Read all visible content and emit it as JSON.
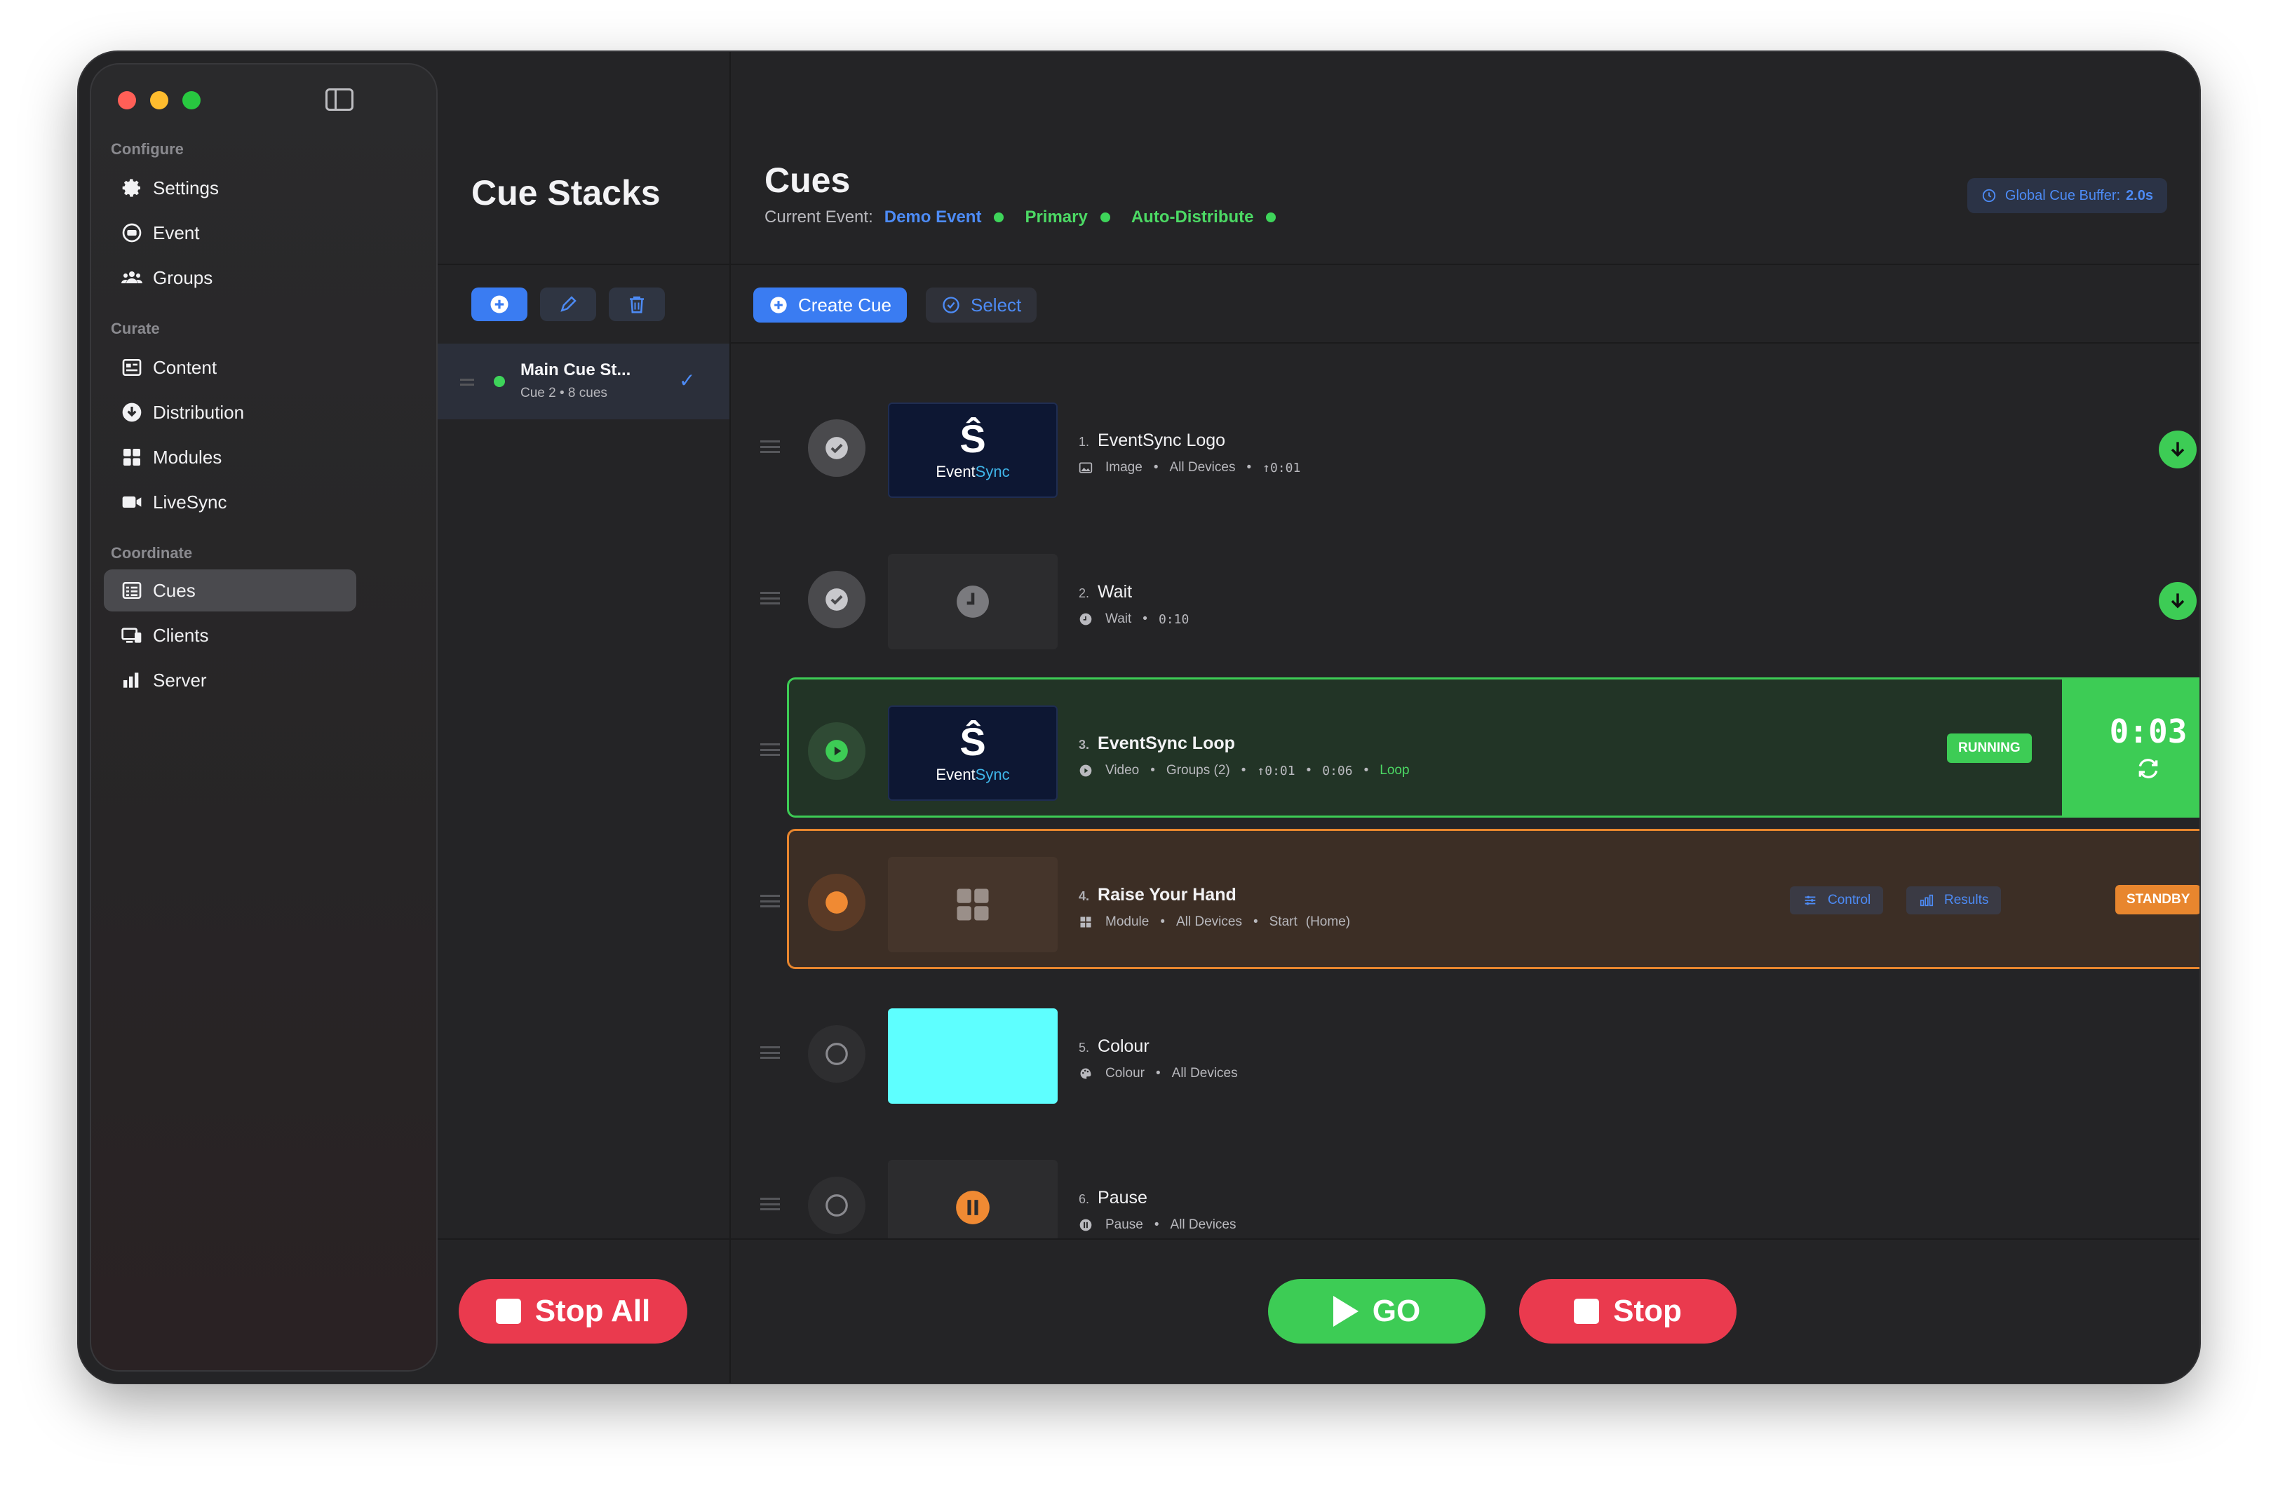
{
  "sidebar": {
    "sections": [
      {
        "title": "Configure",
        "items": [
          {
            "label": "Settings",
            "icon": "gear-icon"
          },
          {
            "label": "Event",
            "icon": "event-icon"
          },
          {
            "label": "Groups",
            "icon": "groups-icon"
          }
        ]
      },
      {
        "title": "Curate",
        "items": [
          {
            "label": "Content",
            "icon": "content-icon"
          },
          {
            "label": "Distribution",
            "icon": "download-circle-icon"
          },
          {
            "label": "Modules",
            "icon": "grid-icon"
          },
          {
            "label": "LiveSync",
            "icon": "video-camera-icon"
          }
        ]
      },
      {
        "title": "Coordinate",
        "items": [
          {
            "label": "Cues",
            "icon": "cues-list-icon",
            "active": true
          },
          {
            "label": "Clients",
            "icon": "clients-icon"
          },
          {
            "label": "Server",
            "icon": "server-chart-icon"
          }
        ]
      }
    ]
  },
  "stacks": {
    "title": "Cue Stacks",
    "items": [
      {
        "name": "Main Cue St...",
        "cue": "Cue 2",
        "count": "8 cues",
        "selected": true
      }
    ],
    "stop_all_label": "Stop All"
  },
  "main": {
    "title": "Cues",
    "current_event_label": "Current Event:",
    "event_name": "Demo Event",
    "mode": "Primary",
    "distribution": "Auto-Distribute",
    "buffer_label": "Global Cue Buffer:",
    "buffer_value": "2.0s",
    "create_label": "Create Cue",
    "select_label": "Select",
    "go_label": "GO",
    "stop_label": "Stop"
  },
  "cues": [
    {
      "num": "1.",
      "title": "EventSync Logo",
      "type": "Image",
      "target": "All Devices",
      "time": "↑0:01",
      "state": "done",
      "logo_text": "Event",
      "logo_accent": "Sync"
    },
    {
      "num": "2.",
      "title": "Wait",
      "type": "Wait",
      "time": "0:10",
      "state": "done"
    },
    {
      "num": "3.",
      "title": "EventSync Loop",
      "type": "Video",
      "target": "Groups (2)",
      "time": "↑0:01",
      "duration": "0:06",
      "loop": "Loop",
      "state": "running",
      "badge": "RUNNING",
      "timer": "0:03",
      "logo_text": "Event",
      "logo_accent": "Sync"
    },
    {
      "num": "4.",
      "title": "Raise Your Hand",
      "type": "Module",
      "target": "All Devices",
      "action": "Start",
      "page": "(Home)",
      "state": "standby",
      "badge": "STANDBY",
      "control_label": "Control",
      "results_label": "Results"
    },
    {
      "num": "5.",
      "title": "Colour",
      "type": "Colour",
      "target": "All Devices",
      "state": "idle",
      "swatch": "#5effff"
    },
    {
      "num": "6.",
      "title": "Pause",
      "type": "Pause",
      "target": "All Devices",
      "state": "idle"
    }
  ],
  "colors": {
    "accent_blue": "#3a7cf2",
    "go_green": "#3dcc55",
    "stop_red": "#ea3a4e",
    "standby_orange": "#e8862e"
  }
}
